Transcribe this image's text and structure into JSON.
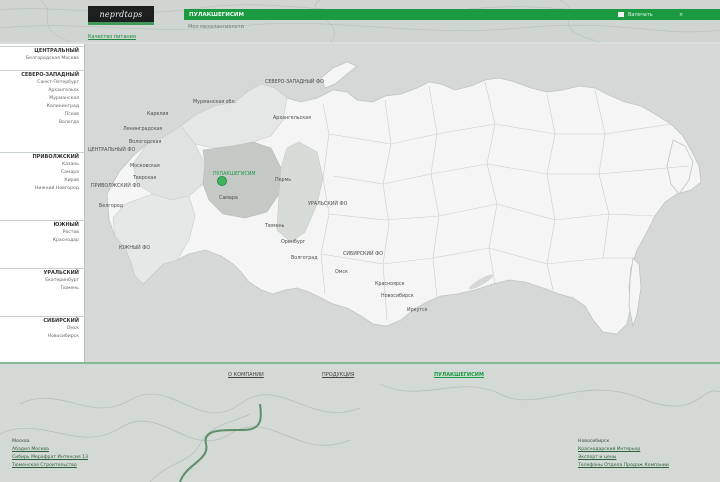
{
  "header": {
    "logo": "neprdtaps",
    "logo_caption": "Качество питания",
    "title": "ПУЛАКШЕГИСИМ",
    "subtitle": "Мол мехалангиолоти",
    "print_label": "Вапечать",
    "close_label": "×"
  },
  "sidebar": {
    "groups": [
      {
        "title": "ЦЕНТРАЛЬНЫЙ",
        "items": [
          "Белгородская Москва"
        ]
      },
      {
        "title": "СЕВЕРО-ЗАПАДНЫЙ",
        "items": [
          "Санкт-Петербург",
          "Архангельск",
          "Мурманская",
          "Калининград",
          "Псков",
          "Вологда"
        ]
      },
      {
        "title": "ПРИВОЛЖСКИЙ",
        "items": [
          "Казань",
          "Самара",
          "Киров",
          "Нижний Новгород"
        ]
      },
      {
        "title": "ЮЖНЫЙ",
        "items": [
          "Ростов",
          "Краснодар"
        ]
      },
      {
        "title": "УРАЛЬСКИЙ",
        "items": [
          "Екатеринбург",
          "Тюмень"
        ]
      },
      {
        "title": "СИБИРСКИЙ",
        "items": [
          "Омск",
          "Новосибирск"
        ]
      }
    ]
  },
  "map": {
    "labels": [
      {
        "text": "СЕВЕРО-ЗАПАДНЫЙ ФО"
      },
      {
        "text": "Мурманская обл."
      },
      {
        "text": "Карелия"
      },
      {
        "text": "Ленинградская"
      },
      {
        "text": "Архангельская"
      },
      {
        "text": "Вологодская"
      },
      {
        "text": "ЦЕНТРАЛЬНЫЙ ФО"
      },
      {
        "text": "Московская"
      },
      {
        "text": "Тверская"
      },
      {
        "text": "ПРИВОЛЖСКИЙ ФО"
      },
      {
        "text": "Белгород"
      },
      {
        "text": "ПУЛАКШЕГИСИМ",
        "active": true
      },
      {
        "text": "Пермь"
      },
      {
        "text": "Самара"
      },
      {
        "text": "УРАЛЬСКИЙ ФО"
      },
      {
        "text": "Тюмень"
      },
      {
        "text": "Оренбург"
      },
      {
        "text": "ЮЖНЫЙ ФО"
      },
      {
        "text": "Волгоград"
      },
      {
        "text": "Омск"
      },
      {
        "text": "СИБИРСКИЙ ФО"
      },
      {
        "text": "Красноярск"
      },
      {
        "text": "Новосибирск"
      },
      {
        "text": "Иркутск"
      }
    ],
    "colors": {
      "land": "#f4f5f4",
      "active_region": "#c4c9c6",
      "sea": "#d5d8d6",
      "accent": "#1b9a42"
    }
  },
  "footer": {
    "tabs": [
      {
        "label": "О КОМПАНИИ"
      },
      {
        "label": "ПРОДУКЦИЯ"
      },
      {
        "label": "ПУЛАКШЕГИСИМ",
        "active": true
      }
    ],
    "left_lines": [
      "Москва",
      "Абадил Москва",
      "Сибирь Мерафрат Интенсия 13",
      "Тюменская Строительство"
    ],
    "right_lines": [
      "Новосибирск",
      "Краснодарский Интерьер",
      "Экспорт и цены",
      "Телефоны Отдела Продаж Компании"
    ]
  }
}
